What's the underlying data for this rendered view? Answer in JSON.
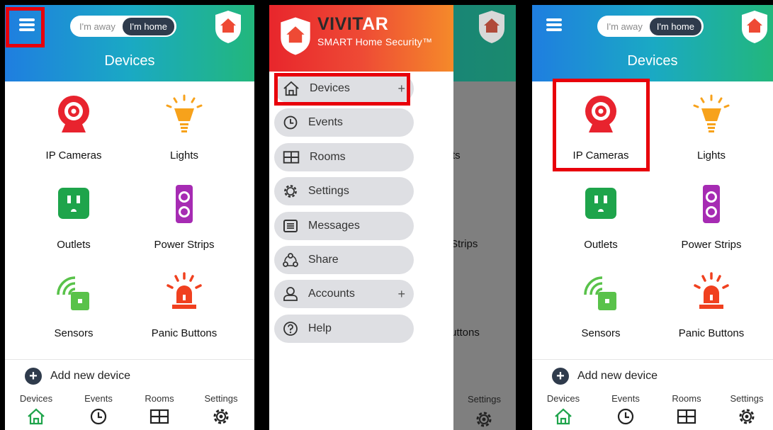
{
  "mode_toggle": {
    "away_label": "I'm away",
    "home_label": "I'm home",
    "active": "home"
  },
  "page_title": "Devices",
  "devices": [
    {
      "label": "IP Cameras",
      "icon": "camera-icon"
    },
    {
      "label": "Lights",
      "icon": "light-bulb-icon"
    },
    {
      "label": "Outlets",
      "icon": "outlet-icon"
    },
    {
      "label": "Power Strips",
      "icon": "power-strip-icon"
    },
    {
      "label": "Sensors",
      "icon": "sensor-icon"
    },
    {
      "label": "Panic Buttons",
      "icon": "siren-icon"
    }
  ],
  "add_device_label": "Add new device",
  "tabs": [
    {
      "label": "Devices",
      "icon": "home-icon"
    },
    {
      "label": "Events",
      "icon": "clock-icon"
    },
    {
      "label": "Rooms",
      "icon": "grid-icon"
    },
    {
      "label": "Settings",
      "icon": "gear-icon"
    }
  ],
  "drawer": {
    "brand_name_part1": "VIVIT",
    "brand_name_part2": "AR",
    "brand_tagline": "SMART Home Security™",
    "items": [
      {
        "label": "Devices",
        "icon": "home-icon",
        "expand": "+"
      },
      {
        "label": "Events",
        "icon": "clock-icon"
      },
      {
        "label": "Rooms",
        "icon": "grid-icon"
      },
      {
        "label": "Settings",
        "icon": "gear-icon"
      },
      {
        "label": "Messages",
        "icon": "message-icon"
      },
      {
        "label": "Share",
        "icon": "share-icon"
      },
      {
        "label": "Accounts",
        "icon": "user-icon",
        "expand": "+"
      },
      {
        "label": "Help",
        "icon": "help-icon"
      }
    ],
    "background_peek": {
      "lights_partial": "ts",
      "strips_partial": "Strips",
      "buttons_partial": "uttons",
      "settings_label": "Settings"
    }
  },
  "colors": {
    "header_gradient_start": "#1f7ee0",
    "header_gradient_end": "#22b77c",
    "drawer_gradient_start": "#e8262c",
    "drawer_gradient_end": "#f58a2a",
    "highlight_box": "#e8000b",
    "camera": "#e8232e",
    "light": "#f7a21b",
    "outlet": "#1ea44b",
    "power_strip": "#a62bb3",
    "sensor": "#59c24a",
    "siren": "#f0401f"
  }
}
